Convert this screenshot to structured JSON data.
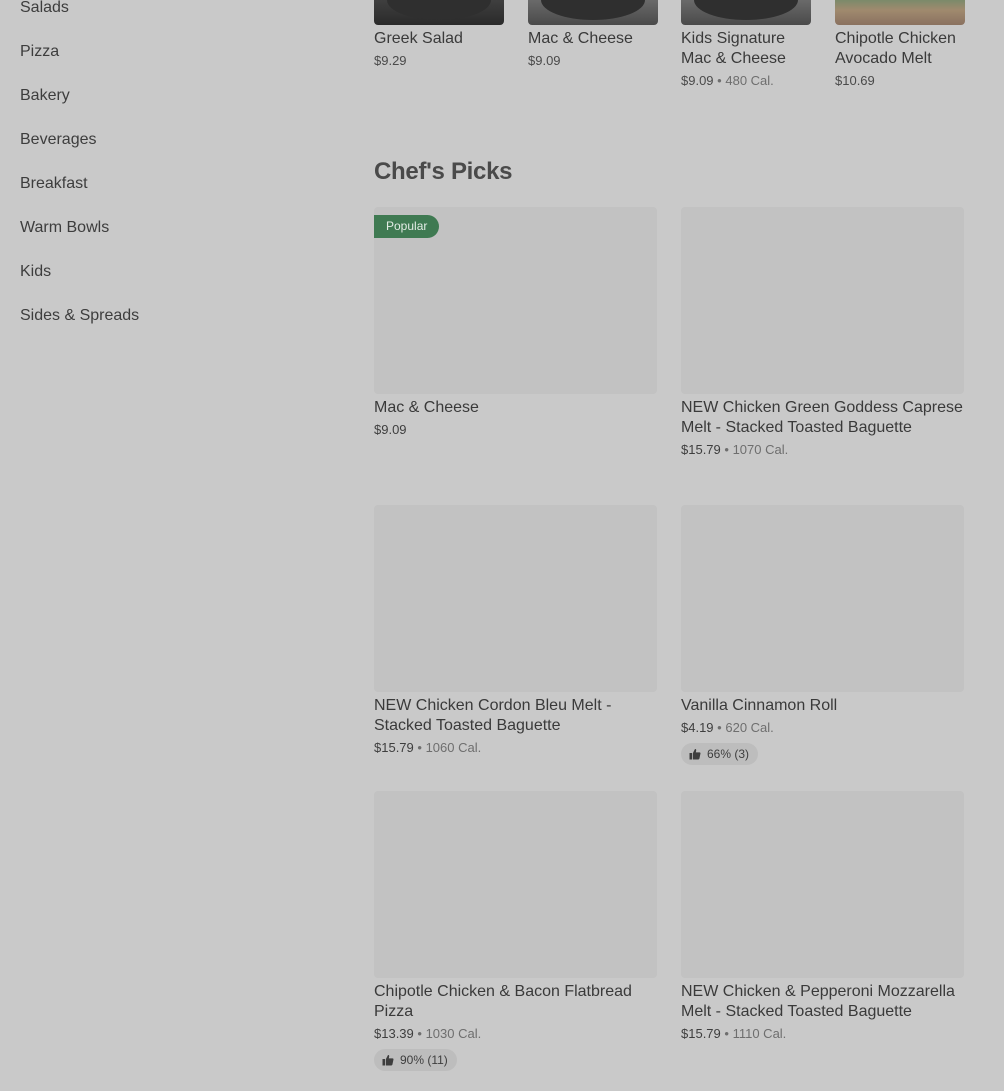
{
  "sidebar": {
    "items": [
      "Salads",
      "Pizza",
      "Bakery",
      "Beverages",
      "Breakfast",
      "Warm Bowls",
      "Kids",
      "Sides & Spreads"
    ]
  },
  "top_items": [
    {
      "name": "Greek Salad",
      "price": "$9.29",
      "cal": ""
    },
    {
      "name": "Mac & Cheese",
      "price": "$9.09",
      "cal": ""
    },
    {
      "name": "Kids Signature Mac & Cheese",
      "price": "$9.09",
      "cal": "480 Cal."
    },
    {
      "name": "Chipotle Chicken Avocado Melt",
      "price": "$10.69",
      "cal": ""
    }
  ],
  "section": {
    "title": "Chef's Picks"
  },
  "picks": [
    {
      "badge": "Popular",
      "name": "Mac & Cheese",
      "price": "$9.09",
      "cal": "",
      "rating": ""
    },
    {
      "badge": "",
      "name": "NEW Chicken Green Goddess Caprese Melt - Stacked Toasted Baguette",
      "price": "$15.79",
      "cal": "1070 Cal.",
      "rating": ""
    },
    {
      "badge": "",
      "name": "NEW Chicken Cordon Bleu Melt - Stacked Toasted Baguette",
      "price": "$15.79",
      "cal": "1060 Cal.",
      "rating": ""
    },
    {
      "badge": "",
      "name": "Vanilla Cinnamon Roll",
      "price": "$4.19",
      "cal": "620 Cal.",
      "rating": "66% (3)"
    },
    {
      "badge": "",
      "name": "Chipotle Chicken & Bacon Flatbread Pizza",
      "price": "$13.39",
      "cal": "1030 Cal.",
      "rating": "90% (11)"
    },
    {
      "badge": "",
      "name": "NEW Chicken & Pepperoni Mozzarella Melt - Stacked Toasted Baguette",
      "price": "$15.79",
      "cal": "1110 Cal.",
      "rating": ""
    }
  ],
  "separator": "•",
  "icons": {
    "rating": "thumbs-up-icon"
  }
}
